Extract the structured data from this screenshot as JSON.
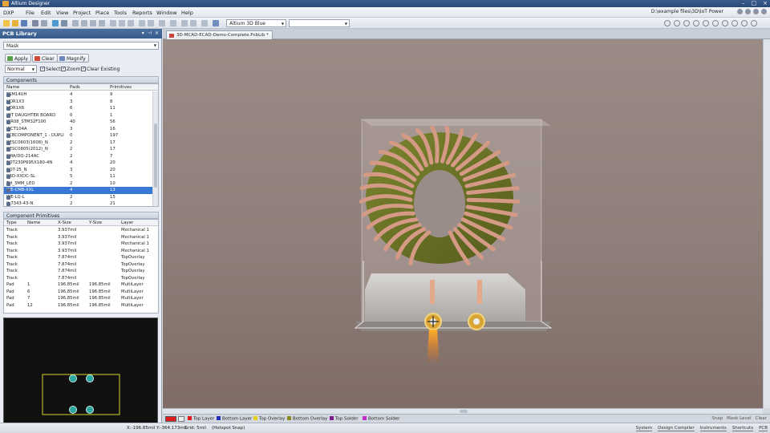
{
  "window": {
    "title": "Altium Designer"
  },
  "menu": [
    "DXP",
    "File",
    "Edit",
    "View",
    "Project",
    "Place",
    "Tools",
    "Reports",
    "Window",
    "Help"
  ],
  "path_text": "D:\\example files\\3D\\IoT Power",
  "toolbar": {
    "view_config": "Altium 3D Blue",
    "second_combo": ""
  },
  "panel": {
    "title": "PCB Library",
    "mask_label": "Mask",
    "buttons": {
      "apply": "Apply",
      "clear": "Clear",
      "magnify": "Magnify"
    },
    "mode": "Normal",
    "checks": {
      "select": "Select",
      "zoom": "Zoom",
      "clear_existing": "Clear Existing"
    },
    "components": {
      "section": "Components",
      "headers": [
        "Name",
        "Pads",
        "Primitives"
      ],
      "rows": [
        [
          "FSM14UH",
          "4",
          "9"
        ],
        [
          "HDR1X3",
          "3",
          "8"
        ],
        [
          "HDR1X6",
          "6",
          "11"
        ],
        [
          "IOT DAUGHTER BOARD",
          "0",
          "1"
        ],
        [
          "ICR08_STM32F100",
          "40",
          "56"
        ],
        [
          "IRCT104A",
          "3",
          "16"
        ],
        [
          "PCBCOMPONENT_1 - DUPLI",
          "0",
          "197"
        ],
        [
          "RESC0603(1608)_N",
          "2",
          "17"
        ],
        [
          "RESC0805(2012)_N",
          "2",
          "17"
        ],
        [
          "SMA/DO-214AC",
          "2",
          "7"
        ],
        [
          "SOT230P695X180-4N",
          "4",
          "20"
        ],
        [
          "SOT-25_N",
          "3",
          "20"
        ],
        [
          "SRD-XXDC-SL",
          "5",
          "11"
        ],
        [
          "TH_3MM_LED",
          "2",
          "10"
        ],
        [
          "WE-CMB-XXL",
          "4",
          "13"
        ],
        [
          "WE-LQ-L",
          "2",
          "15"
        ],
        [
          "X-7343-43-N",
          "2",
          "21"
        ]
      ],
      "selected_index": 14
    },
    "primitives": {
      "section": "Component Primitives",
      "headers": [
        "Type",
        "Name",
        "X-Size",
        "Y-Size",
        "Layer"
      ],
      "rows": [
        [
          "Track",
          "",
          "3.937mil",
          "",
          "Mechanical 1"
        ],
        [
          "Track",
          "",
          "3.937mil",
          "",
          "Mechanical 1"
        ],
        [
          "Track",
          "",
          "3.937mil",
          "",
          "Mechanical 1"
        ],
        [
          "Track",
          "",
          "3.937mil",
          "",
          "Mechanical 1"
        ],
        [
          "Track",
          "",
          "7.874mil",
          "",
          "TopOverlay"
        ],
        [
          "Track",
          "",
          "7.874mil",
          "",
          "TopOverlay"
        ],
        [
          "Track",
          "",
          "7.874mil",
          "",
          "TopOverlay"
        ],
        [
          "Track",
          "",
          "7.874mil",
          "",
          "TopOverlay"
        ],
        [
          "Pad",
          "1",
          "196.85mil",
          "196.85mil",
          "MultiLayer"
        ],
        [
          "Pad",
          "6",
          "196.85mil",
          "196.85mil",
          "MultiLayer"
        ],
        [
          "Pad",
          "7",
          "196.85mil",
          "196.85mil",
          "MultiLayer"
        ],
        [
          "Pad",
          "12",
          "196.85mil",
          "196.85mil",
          "MultiLayer"
        ]
      ]
    }
  },
  "document": {
    "tab": "3D-MCAD-ECAD-Demo-Complete.PcbLib *"
  },
  "layers": [
    {
      "name": "Top Layer",
      "color": "#e01b1b"
    },
    {
      "name": "Bottom Layer",
      "color": "#1f2fb8"
    },
    {
      "name": "Top Overlay",
      "color": "#e6d21d"
    },
    {
      "name": "Bottom Overlay",
      "color": "#8a8a22"
    },
    {
      "name": "Top Solder",
      "color": "#7a1c8a"
    },
    {
      "name": "Bottom Solder",
      "color": "#c02ec8"
    }
  ],
  "layer_right": [
    "Snap",
    "Mask Level",
    "Clear"
  ],
  "status": {
    "coords": "X:-196.85mil Y:-364.173mil",
    "grid": "Grid: 5mil",
    "snap": "(Hotspot Snap)"
  },
  "status_panels": [
    "System",
    "Design Compiler",
    "Instruments",
    "Shortcuts",
    "PCB"
  ],
  "colors": {
    "selected_row": "#3778d6",
    "panel_header": "#355b8c",
    "viewport_bg": "#8f7e79",
    "toroid_core": "#6b7326",
    "copper_wire": "#d59a86"
  }
}
